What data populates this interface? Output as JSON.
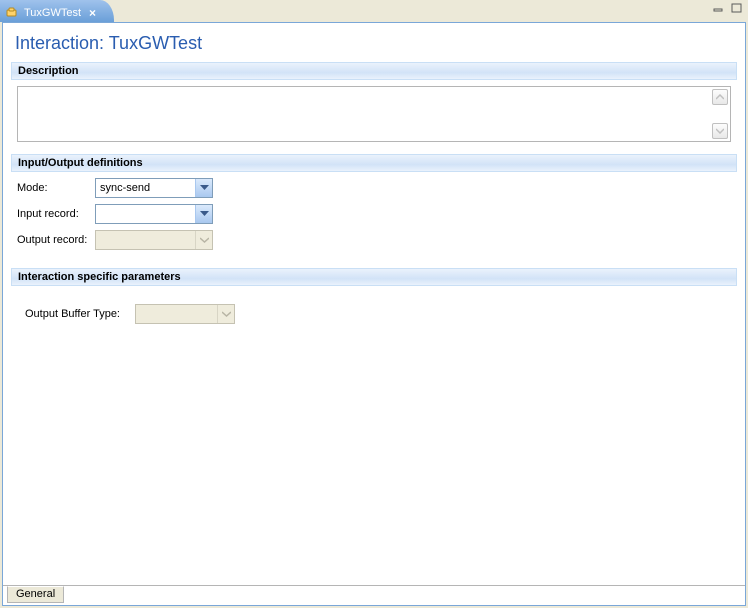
{
  "tab": {
    "title": "TuxGWTest"
  },
  "page": {
    "title": "Interaction: TuxGWTest"
  },
  "sections": {
    "description": {
      "header": "Description",
      "value": ""
    },
    "io": {
      "header": "Input/Output definitions",
      "mode": {
        "label": "Mode:",
        "value": "sync-send"
      },
      "inputRecord": {
        "label": "Input record:",
        "value": ""
      },
      "outputRecord": {
        "label": "Output record:",
        "value": ""
      }
    },
    "params": {
      "header": "Interaction specific parameters",
      "outputBufferType": {
        "label": "Output Buffer Type:",
        "value": ""
      }
    }
  },
  "bottomTab": {
    "label": "General"
  }
}
